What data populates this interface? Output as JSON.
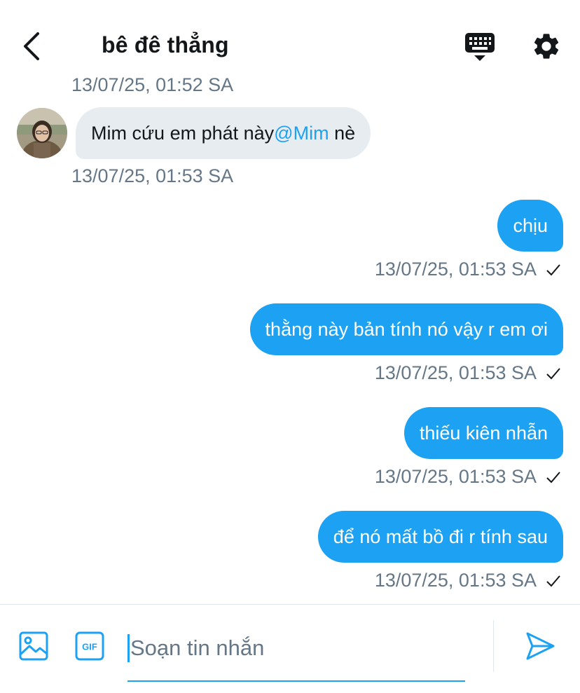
{
  "header": {
    "title": "bê đê thẳng",
    "back_icon": "chevron-left-icon",
    "keyboard_icon": "keyboard-icon",
    "settings_icon": "gear-icon"
  },
  "conversation": {
    "clipped_timestamp": "13/07/25, 01:52 SA",
    "incoming": {
      "avatar_icon": "avatar",
      "text_before": "Mim cứu em phát này",
      "mention": "@Mim",
      "text_after": " nè",
      "timestamp": "13/07/25, 01:53 SA"
    },
    "outgoing": [
      {
        "text": "chịu",
        "timestamp": "13/07/25, 01:53 SA",
        "status_icon": "check-icon"
      },
      {
        "text": "thằng này bản tính nó vậy r em ơi",
        "timestamp": "13/07/25, 01:53 SA",
        "status_icon": "check-icon"
      },
      {
        "text": "thiếu kiên nhẫn",
        "timestamp": "13/07/25, 01:53 SA",
        "status_icon": "check-icon"
      },
      {
        "text": "để nó mất bồ đi r tính sau",
        "timestamp": "13/07/25, 01:53 SA",
        "status_icon": "check-icon"
      }
    ]
  },
  "composer": {
    "placeholder": "Soạn tin nhắn",
    "value": "",
    "image_icon": "image-icon",
    "gif_icon": "gif-icon",
    "gif_label": "GIF",
    "send_icon": "send-icon"
  },
  "colors": {
    "accent": "#1da1f2",
    "incoming_bubble": "#e6ecf0",
    "timestamp": "#657786",
    "text": "#14171a"
  }
}
